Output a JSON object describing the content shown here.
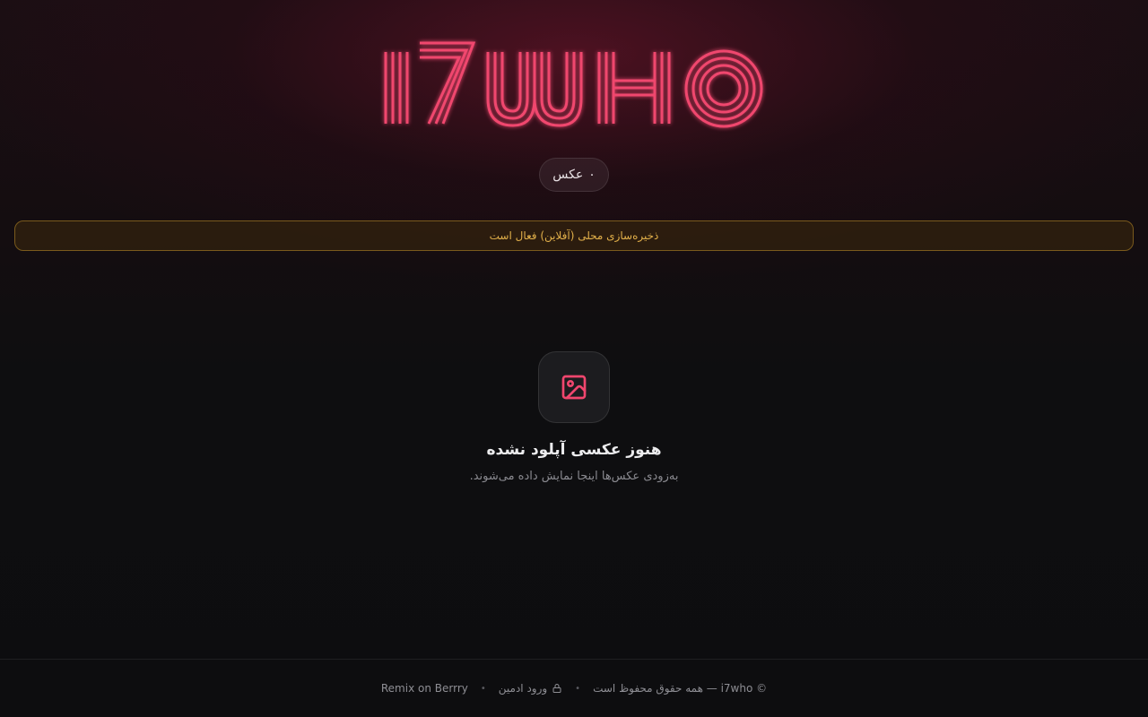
{
  "brand": {
    "logo_text": "i7who",
    "accent": "#f0466e"
  },
  "stats": {
    "count": "۰",
    "label": "عکس"
  },
  "banner": {
    "text": "ذخیره‌سازی محلی (آفلاین) فعال است",
    "color": "#e2b04a"
  },
  "empty_state": {
    "icon": "image-icon",
    "title": "هنوز عکسی آپلود نشده",
    "subtitle": "به‌زودی عکس‌ها اینجا نمایش داده می‌شوند."
  },
  "footer": {
    "copyright": "© i7who — همه حقوق محفوظ است",
    "separator": "•",
    "admin_label": "ورود ادمین",
    "admin_icon": "lock-icon",
    "remix_label": "Remix on Berrry"
  }
}
